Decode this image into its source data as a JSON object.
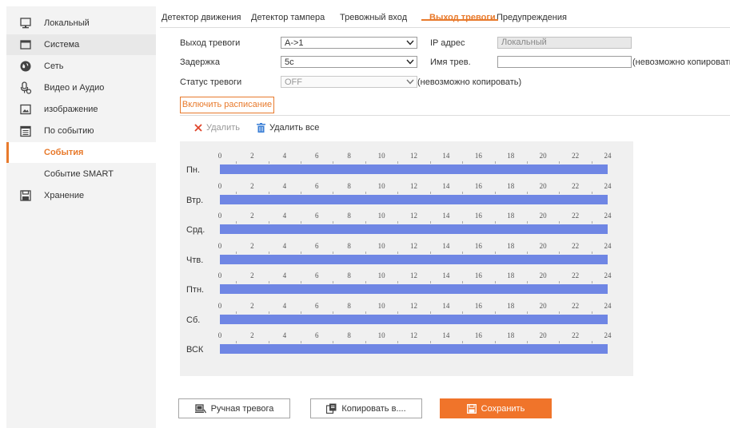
{
  "sidebar": {
    "items": [
      {
        "label": "Локальный",
        "icon": "monitor-icon"
      },
      {
        "label": "Система",
        "icon": "window-icon"
      },
      {
        "label": "Сеть",
        "icon": "globe-icon"
      },
      {
        "label": "Видео и Аудио",
        "icon": "microphone-icon"
      },
      {
        "label": "изображение",
        "icon": "image-icon"
      },
      {
        "label": "По событию",
        "icon": "calendar-icon"
      },
      {
        "label": "События",
        "icon": ""
      },
      {
        "label": "Событие SMART",
        "icon": ""
      },
      {
        "label": "Хранение",
        "icon": "floppy-icon"
      }
    ]
  },
  "tabs": [
    {
      "label": "Детектор движения"
    },
    {
      "label": "Детектор тампера"
    },
    {
      "label": "Тревожный вход"
    },
    {
      "label": "Выход тревоги",
      "active": true
    },
    {
      "label": "Предупреждения"
    }
  ],
  "form": {
    "alarm_output_label": "Выход тревоги",
    "alarm_output_value": "A->1",
    "delay_label": "Задержка",
    "delay_value": "5c",
    "alarm_status_label": "Статус тревоги",
    "alarm_status_value": "OFF",
    "alarm_status_note": "(невозможно копировать)",
    "ip_label": "IP адрес",
    "ip_value": "Локальный",
    "alarm_name_label": "Имя трев.",
    "alarm_name_value": "",
    "alarm_name_note": "(невозможно копировать)"
  },
  "schedule": {
    "enable_button": "Включить расписание",
    "delete_label": "Удалить",
    "delete_all_label": "Удалить все",
    "days": [
      "Пн.",
      "Втр.",
      "Срд.",
      "Чтв.",
      "Птн.",
      "Сб.",
      "ВСК"
    ],
    "hours": [
      "0",
      "2",
      "4",
      "6",
      "8",
      "10",
      "12",
      "14",
      "16",
      "18",
      "20",
      "22",
      "24"
    ],
    "bar_color": "#6f86e4"
  },
  "buttons": {
    "manual_alarm": "Ручная тревога",
    "copy": "Копировать в....",
    "save": "Сохранить"
  },
  "colors": {
    "accent": "#e87a2c",
    "save_button": "#f0742a"
  }
}
